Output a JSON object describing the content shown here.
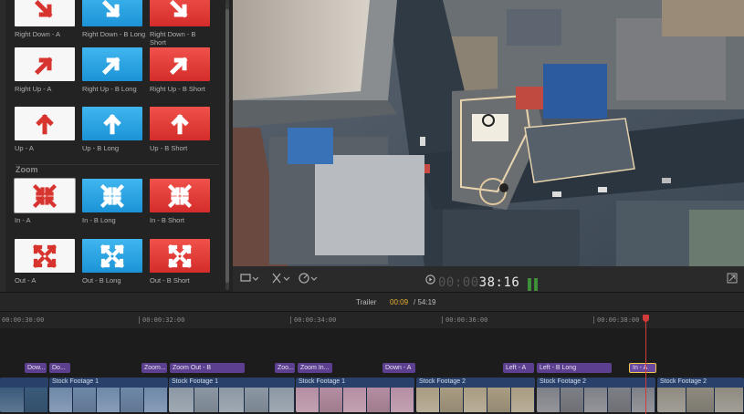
{
  "browser": {
    "rows": [
      {
        "tiles": [
          {
            "label": "Right Down - A",
            "style": "white",
            "arrow": "right-down",
            "icon": "arrow-down-right-icon"
          },
          {
            "label": "Right Down - B Long",
            "style": "blue",
            "arrow": "right-down",
            "icon": "arrow-down-right-icon"
          },
          {
            "label": "Right Down - B Short",
            "style": "red",
            "arrow": "right-down",
            "icon": "arrow-down-right-icon"
          }
        ]
      },
      {
        "tiles": [
          {
            "label": "Right Up - A",
            "style": "white",
            "arrow": "right-up",
            "icon": "arrow-up-right-icon"
          },
          {
            "label": "Right Up - B Long",
            "style": "blue",
            "arrow": "right-up",
            "icon": "arrow-up-right-icon"
          },
          {
            "label": "Right Up - B Short",
            "style": "red",
            "arrow": "right-up",
            "icon": "arrow-up-right-icon"
          }
        ]
      },
      {
        "tiles": [
          {
            "label": "Up - A",
            "style": "white",
            "arrow": "up",
            "icon": "arrow-up-icon"
          },
          {
            "label": "Up - B Long",
            "style": "blue",
            "arrow": "up",
            "icon": "arrow-up-icon"
          },
          {
            "label": "Up - B Short",
            "style": "red",
            "arrow": "up",
            "icon": "arrow-up-icon"
          }
        ]
      }
    ],
    "zoom_section": {
      "title": "Zoom",
      "rows": [
        {
          "tiles": [
            {
              "label": "In - A",
              "style": "white",
              "arrow": "in",
              "icon": "zoom-in-arrows-icon",
              "selected": true
            },
            {
              "label": "In - B Long",
              "style": "blue",
              "arrow": "in",
              "icon": "zoom-in-arrows-icon"
            },
            {
              "label": "In - B Short",
              "style": "red",
              "arrow": "in",
              "icon": "zoom-in-arrows-icon"
            }
          ]
        },
        {
          "tiles": [
            {
              "label": "Out - A",
              "style": "white",
              "arrow": "out",
              "icon": "zoom-out-arrows-icon"
            },
            {
              "label": "Out - B Long",
              "style": "blue",
              "arrow": "out",
              "icon": "zoom-out-arrows-icon"
            },
            {
              "label": "Out - B Short",
              "style": "red",
              "arrow": "out",
              "icon": "zoom-out-arrows-icon"
            }
          ]
        }
      ]
    }
  },
  "viewer": {
    "timecode_dim": "00:00",
    "timecode": "38:16",
    "controls": {
      "display_icon": "monitor-icon",
      "transform_icon": "transform-crop-icon",
      "speed_icon": "speedometer-icon",
      "play_icon": "play-icon",
      "fullscreen_icon": "fullscreen-icon"
    }
  },
  "timeline_header": {
    "project_name": "Trailer",
    "current_time": "00:09",
    "duration": "/ 54:19"
  },
  "ruler": {
    "labels": [
      "00:00:30:00",
      "00:00:32:00",
      "00:00:34:00",
      "00:00:36:00",
      "00:00:38:00"
    ]
  },
  "title_clips": [
    {
      "label": "Dow...",
      "selected": false
    },
    {
      "label": "Do...",
      "selected": false
    },
    {
      "label": "Zoom...",
      "selected": false
    },
    {
      "label": "Zoom Out - B",
      "selected": false
    },
    {
      "label": "Zoo...",
      "selected": false
    },
    {
      "label": "Zoom In...",
      "selected": false
    },
    {
      "label": "Down - A",
      "selected": false
    },
    {
      "label": "Left - A",
      "selected": false
    },
    {
      "label": "Left - B Long",
      "selected": false
    },
    {
      "label": "In - A",
      "selected": true
    }
  ],
  "video_clips": [
    {
      "label": "",
      "tint": "#3a5a7a"
    },
    {
      "label": "Stock Footage 1",
      "tint": "#6e88a8"
    },
    {
      "label": "Stock Footage 1",
      "tint": "#8b97a3"
    },
    {
      "label": "Stock Footage 1",
      "tint": "#b58da2"
    },
    {
      "label": "Stock Footage 2",
      "tint": "#a99c82"
    },
    {
      "label": "Stock Footage 2",
      "tint": "#7d7f86"
    },
    {
      "label": "Stock Footage 2",
      "tint": "#8e8a80"
    }
  ],
  "colors": {
    "accent_time": "#e9b230",
    "title_clip": "#5c3f8f",
    "video_clip": "#28406a",
    "playhead": "#d33a3a",
    "selection": "#f1c74a"
  }
}
